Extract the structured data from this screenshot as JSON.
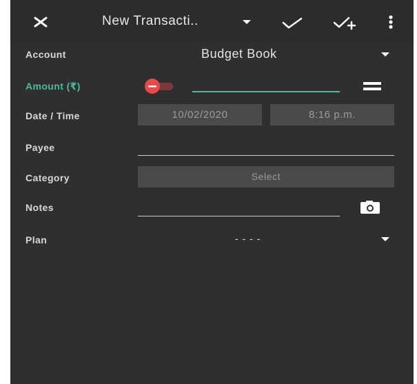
{
  "toolbar": {
    "title": "New Transacti..",
    "icons": [
      "close-icon",
      "chevron-down-icon",
      "check-icon",
      "check-plus-icon",
      "more-vert-icon"
    ]
  },
  "form": {
    "account": {
      "label": "Account",
      "value": "Budget Book"
    },
    "amount": {
      "label": "Amount (₹)",
      "value": ""
    },
    "datetime": {
      "label": "Date / Time",
      "date": "10/02/2020",
      "time": "8:16 p.m."
    },
    "payee": {
      "label": "Payee",
      "value": ""
    },
    "category": {
      "label": "Category",
      "value": "Select"
    },
    "notes": {
      "label": "Notes",
      "value": ""
    },
    "plan": {
      "label": "Plan",
      "value": "- - - -"
    }
  },
  "colors": {
    "background": "#2f2f2f",
    "accent": "#4fb8a0",
    "toggle": "#e84a4a",
    "field_box": "#4a4a4a"
  }
}
